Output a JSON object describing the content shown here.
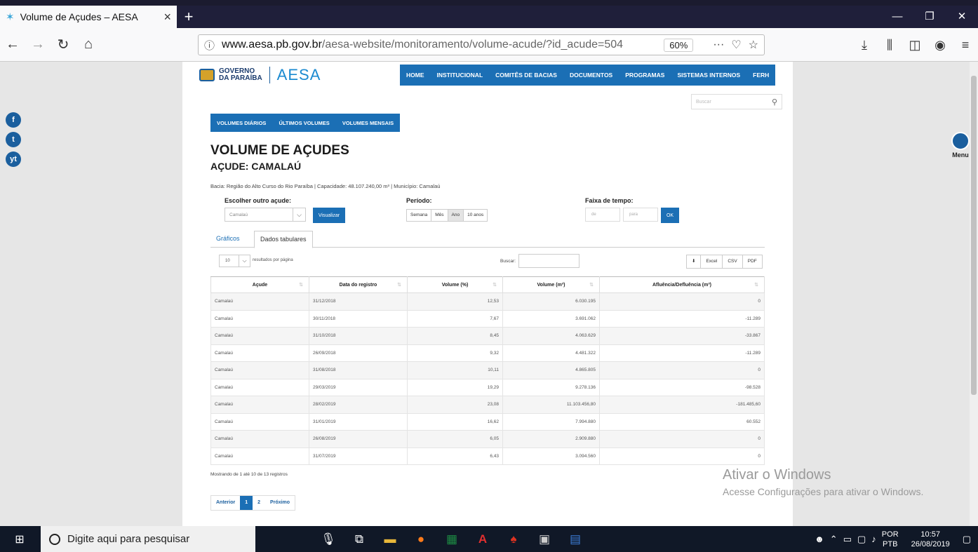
{
  "browser": {
    "tab_title": "Volume de Açudes – AESA",
    "tab_close": "×",
    "new_tab": "+",
    "url_host": "www.aesa.pb.gov.br",
    "url_path": "/aesa-website/monitoramento/volume-acude/?id_acude=504",
    "zoom": "60%",
    "page_actions": "···"
  },
  "site": {
    "gov_line1": "GOVERNO",
    "gov_line2": "DA PARAÍBA",
    "brand": "AESA",
    "nav": [
      "HOME",
      "INSTITUCIONAL",
      "COMITÊS DE BACIAS",
      "DOCUMENTOS",
      "PROGRAMAS",
      "SISTEMAS INTERNOS",
      "FERH"
    ],
    "search_placeholder": "Buscar",
    "side_menu_label": "Menu",
    "social": [
      "f",
      "t",
      "yt"
    ]
  },
  "page": {
    "subnav": [
      "VOLUMES DIÁRIOS",
      "ÚLTIMOS VOLUMES",
      "VOLUMES MENSAIS"
    ],
    "title": "VOLUME DE AÇUDES",
    "subtitle": "AÇUDE: CAMALAÚ",
    "meta": "Bacia: Região do Alto Curso do Rio Paraíba | Capacidade: 48.107.240,00 m³ | Município: Camalaú",
    "choose_label": "Escolher outro açude:",
    "choose_value": "Camalaú",
    "view_button": "Visualizar",
    "period_label": "Período:",
    "periods": [
      "Semana",
      "Mês",
      "Ano",
      "10 anos"
    ],
    "range_label": "Faixa de tempo:",
    "range_from": "de",
    "range_to": "para",
    "ok_button": "OK",
    "tab_charts": "Gráficos",
    "tab_table": "Dados tabulares",
    "page_len": "10",
    "page_len_label": "resultados por página",
    "buscar_label": "Buscar:",
    "exports": [
      "Excel",
      "CSV",
      "PDF"
    ],
    "columns": [
      "Açude",
      "Data do registro",
      "Volume (%)",
      "Volume (m³)",
      "Afluência/Defluência (m³)"
    ],
    "rows": [
      [
        "Camalaú",
        "31/12/2018",
        "12,53",
        "6.030.195",
        "0"
      ],
      [
        "Camalaú",
        "30/11/2018",
        "7,67",
        "3.691.062",
        "-11.289"
      ],
      [
        "Camalaú",
        "31/10/2018",
        "8,45",
        "4.063.629",
        "-33.867"
      ],
      [
        "Camalaú",
        "26/09/2018",
        "9,32",
        "4.481.322",
        "-11.289"
      ],
      [
        "Camalaú",
        "31/08/2018",
        "10,11",
        "4.865.805",
        "0"
      ],
      [
        "Camalaú",
        "29/03/2019",
        "19,29",
        "9.278.136",
        "-98.528"
      ],
      [
        "Camalaú",
        "28/02/2019",
        "23,08",
        "11.103.456,80",
        "-181.485,60"
      ],
      [
        "Camalaú",
        "31/01/2019",
        "16,62",
        "7.994.880",
        "60.552"
      ],
      [
        "Camalaú",
        "26/08/2019",
        "6,05",
        "2.909.880",
        "0"
      ],
      [
        "Camalaú",
        "31/07/2019",
        "6,43",
        "3.094.560",
        "0"
      ]
    ],
    "info": "Mostrando de 1 até 10 de 13 registros",
    "pager": [
      "Anterior",
      "1",
      "2",
      "Próximo"
    ]
  },
  "watermark": {
    "line1": "Ativar o Windows",
    "line2": "Acesse Configurações para ativar o Windows."
  },
  "taskbar": {
    "search_placeholder": "Digite aqui para pesquisar",
    "lang1": "POR",
    "lang2": "PTB",
    "time": "10:57",
    "date": "26/08/2019"
  }
}
